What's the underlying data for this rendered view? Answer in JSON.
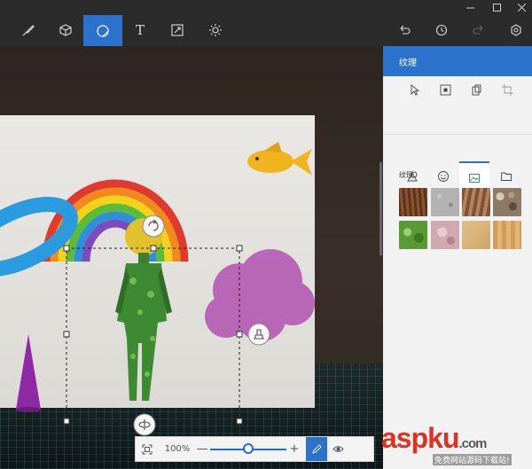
{
  "toolbar": {
    "tools": [
      {
        "id": "brushes",
        "icon": "brush-icon"
      },
      {
        "id": "3d-shapes",
        "icon": "cube-icon"
      },
      {
        "id": "stickers",
        "icon": "sticker-icon",
        "active": true
      },
      {
        "id": "text",
        "icon": "text-icon",
        "glyph": "T"
      },
      {
        "id": "canvas",
        "icon": "resize-icon"
      },
      {
        "id": "effects",
        "icon": "sun-icon"
      }
    ],
    "actions": [
      "undo-icon",
      "history-icon",
      "redo-icon",
      "remix3d-icon"
    ]
  },
  "window_controls": [
    "minimize-icon",
    "maximize-icon",
    "close-icon"
  ],
  "panel": {
    "title": "纹理",
    "modes": [
      "select-icon",
      "center-icon",
      "copy-icon",
      "crop-icon"
    ],
    "categories": [
      "shapes-icon",
      "smiley-icon",
      "image-icon",
      "folder-icon"
    ],
    "active_category": 2,
    "section_label": "纹理",
    "textures": [
      {
        "name": "wood-bark",
        "color": "#7a4a2c"
      },
      {
        "name": "granite",
        "color": "#a9a9a9"
      },
      {
        "name": "wood-grain",
        "color": "#9a6d4b"
      },
      {
        "name": "pebbles",
        "color": "#8c7a66"
      },
      {
        "name": "leaves",
        "color": "#5a9a36"
      },
      {
        "name": "marble-pink",
        "color": "#cfa8b0"
      },
      {
        "name": "sand",
        "color": "#d9b37a"
      },
      {
        "name": "pine",
        "color": "#d8a765"
      }
    ]
  },
  "zoom": {
    "percent_label": "100%",
    "minus": "—",
    "plus": "+",
    "level_fraction": 0.5
  },
  "watermark": {
    "brand": "aspku",
    "suffix": ".com",
    "subtitle": "免费网站源码下载站!"
  },
  "colors": {
    "accent": "#2a72cc",
    "toolbar_bg": "#2b2b2b",
    "panel_bg": "#f2f2f2"
  }
}
